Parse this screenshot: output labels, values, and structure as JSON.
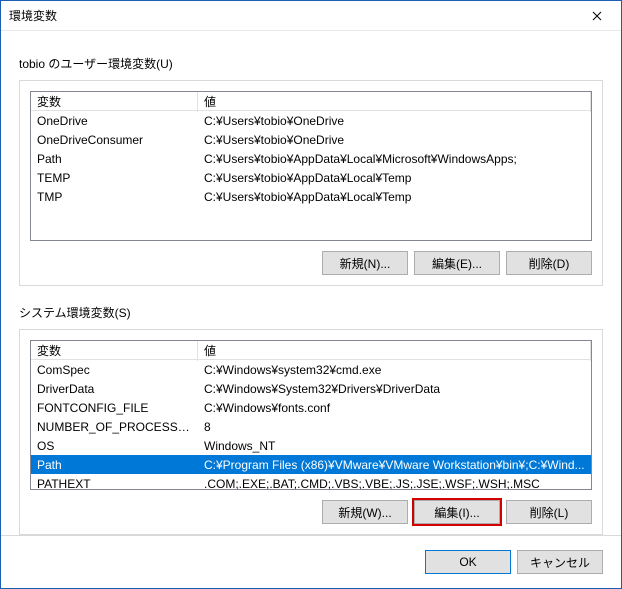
{
  "window": {
    "title": "環境変数"
  },
  "userSection": {
    "heading": "tobio のユーザー環境変数(U)",
    "headers": {
      "name": "変数",
      "value": "値"
    },
    "rows": [
      {
        "name": "OneDrive",
        "value": "C:¥Users¥tobio¥OneDrive"
      },
      {
        "name": "OneDriveConsumer",
        "value": "C:¥Users¥tobio¥OneDrive"
      },
      {
        "name": "Path",
        "value": "C:¥Users¥tobio¥AppData¥Local¥Microsoft¥WindowsApps;"
      },
      {
        "name": "TEMP",
        "value": "C:¥Users¥tobio¥AppData¥Local¥Temp"
      },
      {
        "name": "TMP",
        "value": "C:¥Users¥tobio¥AppData¥Local¥Temp"
      }
    ],
    "buttons": {
      "new": "新規(N)...",
      "edit": "編集(E)...",
      "delete": "削除(D)"
    }
  },
  "systemSection": {
    "heading": "システム環境変数(S)",
    "headers": {
      "name": "変数",
      "value": "値"
    },
    "rows": [
      {
        "name": "ComSpec",
        "value": "C:¥Windows¥system32¥cmd.exe"
      },
      {
        "name": "DriverData",
        "value": "C:¥Windows¥System32¥Drivers¥DriverData"
      },
      {
        "name": "FONTCONFIG_FILE",
        "value": "C:¥Windows¥fonts.conf"
      },
      {
        "name": "NUMBER_OF_PROCESSORS",
        "value": "8"
      },
      {
        "name": "OS",
        "value": "Windows_NT"
      },
      {
        "name": "Path",
        "value": "C:¥Program Files (x86)¥VMware¥VMware Workstation¥bin¥;C:¥Wind...",
        "selected": true
      },
      {
        "name": "PATHEXT",
        "value": ".COM;.EXE;.BAT;.CMD;.VBS;.VBE;.JS;.JSE;.WSF;.WSH;.MSC"
      }
    ],
    "buttons": {
      "new": "新規(W)...",
      "edit": "編集(I)...",
      "delete": "削除(L)"
    }
  },
  "footer": {
    "ok": "OK",
    "cancel": "キャンセル"
  }
}
